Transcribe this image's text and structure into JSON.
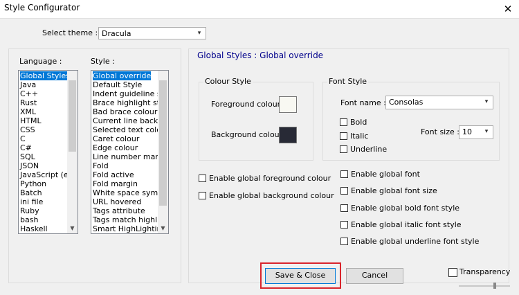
{
  "window": {
    "title": "Style Configurator",
    "close_glyph": "✕"
  },
  "theme": {
    "label": "Select theme :",
    "value": "Dracula"
  },
  "languages": {
    "header": "Language :",
    "items": [
      "Global Styles",
      "Java",
      "C++",
      "Rust",
      "XML",
      "HTML",
      "CSS",
      "C",
      "C#",
      "SQL",
      "JSON",
      "JavaScript (er",
      "Python",
      "Batch",
      "ini file",
      "Ruby",
      "bash",
      "Haskell"
    ],
    "selected_index": 0
  },
  "styles": {
    "header": "Style :",
    "items": [
      "Global override",
      "Default Style",
      "Indent guideline sty",
      "Brace highlight style",
      "Bad brace colour",
      "Current line backgr",
      "Selected text colou",
      "Caret colour",
      "Edge colour",
      "Line number margin",
      "Fold",
      "Fold active",
      "Fold margin",
      "White space symbo",
      "URL hovered",
      "Tags attribute",
      "Tags match highligh",
      "Smart HighLighting"
    ],
    "selected_index": 0
  },
  "panel": {
    "title": "Global Styles : Global override"
  },
  "colour_style": {
    "legend": "Colour Style",
    "foreground_label": "Foreground colour",
    "background_label": "Background colour",
    "foreground_color": "#f8f8f2",
    "background_color": "#282a36"
  },
  "font_style": {
    "legend": "Font Style",
    "font_name_label": "Font name :",
    "font_name_value": "Consolas",
    "font_size_label": "Font size :",
    "font_size_value": "10",
    "bold_label": "Bold",
    "italic_label": "Italic",
    "underline_label": "Underline"
  },
  "global_enable": {
    "fg": "Enable global foreground colour",
    "bg": "Enable global background colour",
    "font": "Enable global font",
    "font_size": "Enable global font size",
    "bold": "Enable global bold font style",
    "italic": "Enable global italic font style",
    "underline": "Enable global underline font style"
  },
  "buttons": {
    "save_close": "Save & Close",
    "cancel": "Cancel"
  },
  "transparency": {
    "label": "Transparency"
  },
  "colors": {
    "highlight_box": "#d9242b",
    "selection": "#0078d7",
    "panel_title": "#00008b"
  }
}
